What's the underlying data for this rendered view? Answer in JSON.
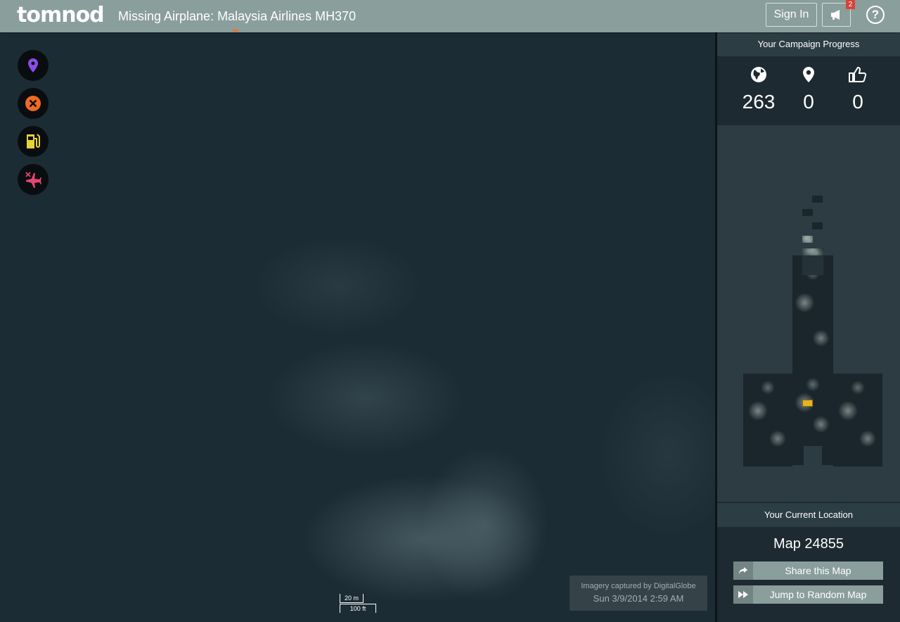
{
  "header": {
    "logo": "tomnod",
    "title": "Missing Airplane: Malaysia Airlines MH370",
    "sign_in": "Sign In",
    "notification_count": "2",
    "help": "?"
  },
  "tools": [
    {
      "name": "tag-location-icon",
      "color": "#8a4de8"
    },
    {
      "name": "wreckage-icon",
      "color": "#f26a21"
    },
    {
      "name": "oil-slick-icon",
      "color": "#e6d335"
    },
    {
      "name": "crashed-plane-icon",
      "color": "#e8456f"
    }
  ],
  "imagery": {
    "credit": "Imagery captured by DigitalGlobe",
    "timestamp": "Sun 3/9/2014 2:59 AM"
  },
  "scale": {
    "metric": "20 m",
    "imperial": "100 ft"
  },
  "panel": {
    "progress_title": "Your Campaign Progress",
    "stats": {
      "maps_viewed": "263",
      "tags_placed": "0",
      "agreements": "0"
    },
    "location_title": "Your Current Location",
    "map_id": "Map 24855",
    "share_label": "Share this Map",
    "jump_label": "Jump to Random Map"
  },
  "colors": {
    "header_bg": "#8a9e9c",
    "current_tile": "#e6b422"
  }
}
